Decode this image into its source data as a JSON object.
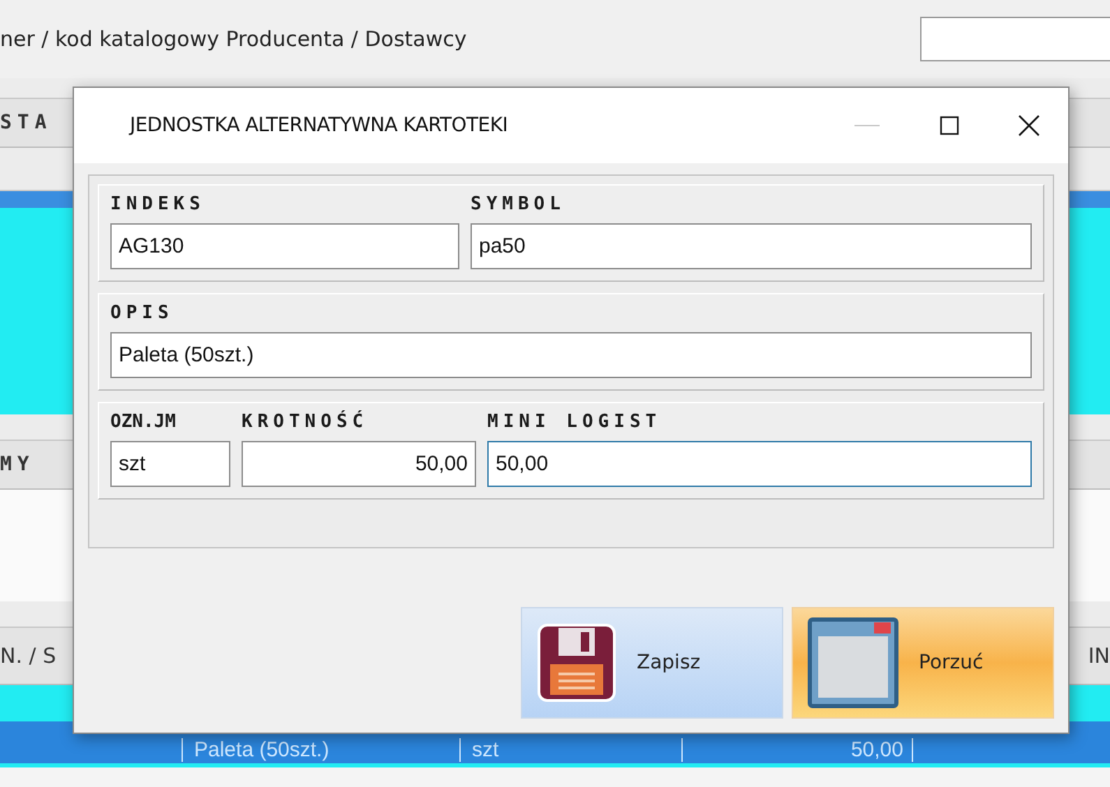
{
  "background": {
    "title": "ner / kod katalogowy Producenta / Dostawcy",
    "band_1": "STA",
    "band_2": "MY",
    "band_3_left": "N. / S",
    "band_3_right": "IN",
    "row_cells": [
      "Paleta (50szt.)",
      "szt",
      "50,00"
    ]
  },
  "dialog": {
    "title": "JEDNOSTKA ALTERNATYWNA KARTOTEKI",
    "window_controls": [
      {
        "kind": "minimize",
        "disabled": true
      },
      {
        "kind": "maximize",
        "disabled": false
      },
      {
        "kind": "close",
        "disabled": false
      }
    ],
    "groups": [
      {
        "fields": [
          {
            "label": "INDEKS",
            "value": "AG130",
            "kind": "text",
            "focused": false
          },
          {
            "label": "SYMBOL",
            "value": "pa50",
            "kind": "text",
            "focused": false
          }
        ]
      },
      {
        "fields": [
          {
            "label": "OPIS",
            "value": "Paleta (50szt.)",
            "kind": "text",
            "focused": false
          }
        ]
      },
      {
        "fields": [
          {
            "label": "OZN.JM",
            "value": "szt",
            "kind": "text",
            "focused": false
          },
          {
            "label": "KROTNOŚĆ",
            "value": "50,00",
            "kind": "number",
            "focused": false
          },
          {
            "label": "MINI LOGIST",
            "value": "50,00",
            "kind": "text",
            "focused": true
          }
        ]
      }
    ],
    "buttons": [
      {
        "kind": "save",
        "label": "Zapisz"
      },
      {
        "kind": "discard",
        "label": "Porzuć"
      }
    ]
  }
}
